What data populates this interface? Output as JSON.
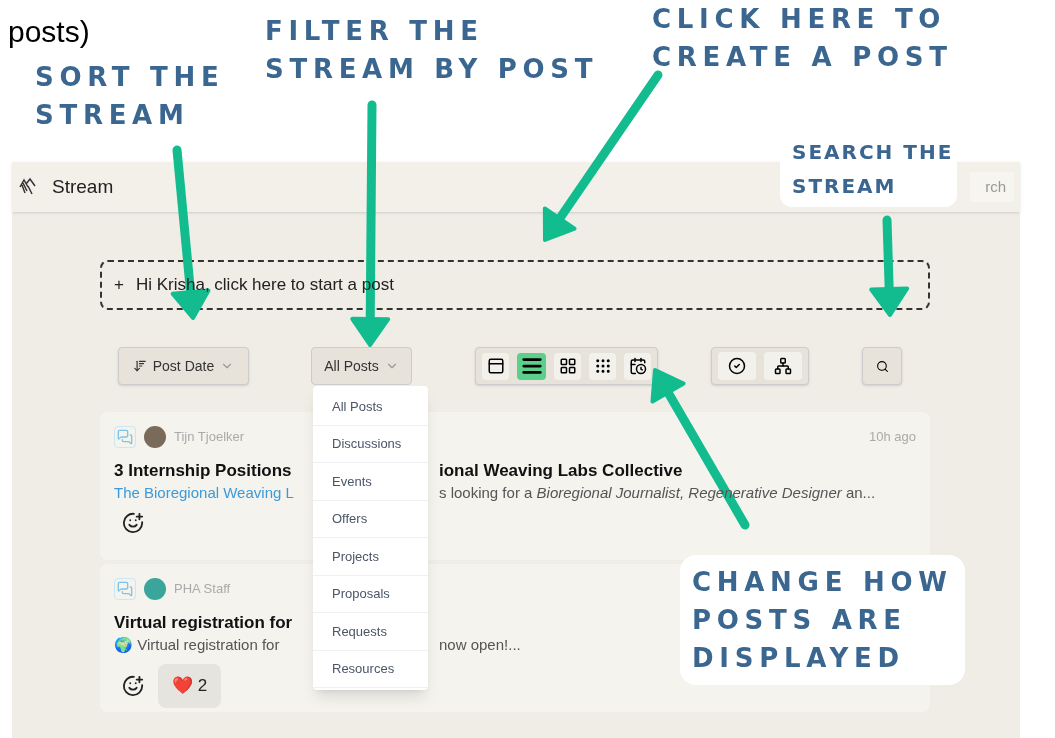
{
  "cut_caption": "posts)",
  "annotations": [
    {
      "lines": [
        "SORT THE",
        "STREAM"
      ]
    },
    {
      "lines": [
        "FILTER THE",
        "STREAM BY POST"
      ]
    },
    {
      "lines": [
        "CLICK HERE TO",
        "CREATE A POST"
      ]
    },
    {
      "lines": [
        "SEARCH THE",
        "STREAM"
      ],
      "boxed": true
    },
    {
      "lines": [
        "CHANGE HOW",
        "POSTS ARE",
        "DISPLAYED"
      ],
      "boxed": true
    }
  ],
  "header": {
    "title": "Stream",
    "search_placeholder": "rch"
  },
  "composer": {
    "icon": "+",
    "text": "Hi Krisha, click here to start a post"
  },
  "toolbar": {
    "sort": "Post Date",
    "filter": "All Posts",
    "views": [
      {
        "kind": "card",
        "selected": false
      },
      {
        "kind": "list",
        "selected": true
      },
      {
        "kind": "grid",
        "selected": false
      },
      {
        "kind": "dense",
        "selected": false
      },
      {
        "kind": "calendar",
        "selected": false
      }
    ],
    "extras": [
      {
        "kind": "check"
      },
      {
        "kind": "tree"
      }
    ]
  },
  "filter_menu": [
    "All Posts",
    "Discussions",
    "Events",
    "Offers",
    "Projects",
    "Proposals",
    "Requests",
    "Resources"
  ],
  "posts": [
    {
      "author": "Tijn Tjoelker",
      "time": "10h ago",
      "title_parts": [
        "3 Internship Positions",
        "ional Weaving Labs Collective"
      ],
      "excerpt_link": "The Bioregional Weaving L",
      "excerpt_end": "s looking for a *Bioregional Journalist, Regenerative Designer* an..."
    },
    {
      "author": "PHA Staff",
      "title_parts": [
        "Virtual registration for"
      ],
      "excerpt_start": "🌍 Virtual registration for",
      "excerpt_end": "now open!...",
      "reactions": [
        {
          "emoji": "❤️",
          "count": "2"
        }
      ]
    }
  ]
}
